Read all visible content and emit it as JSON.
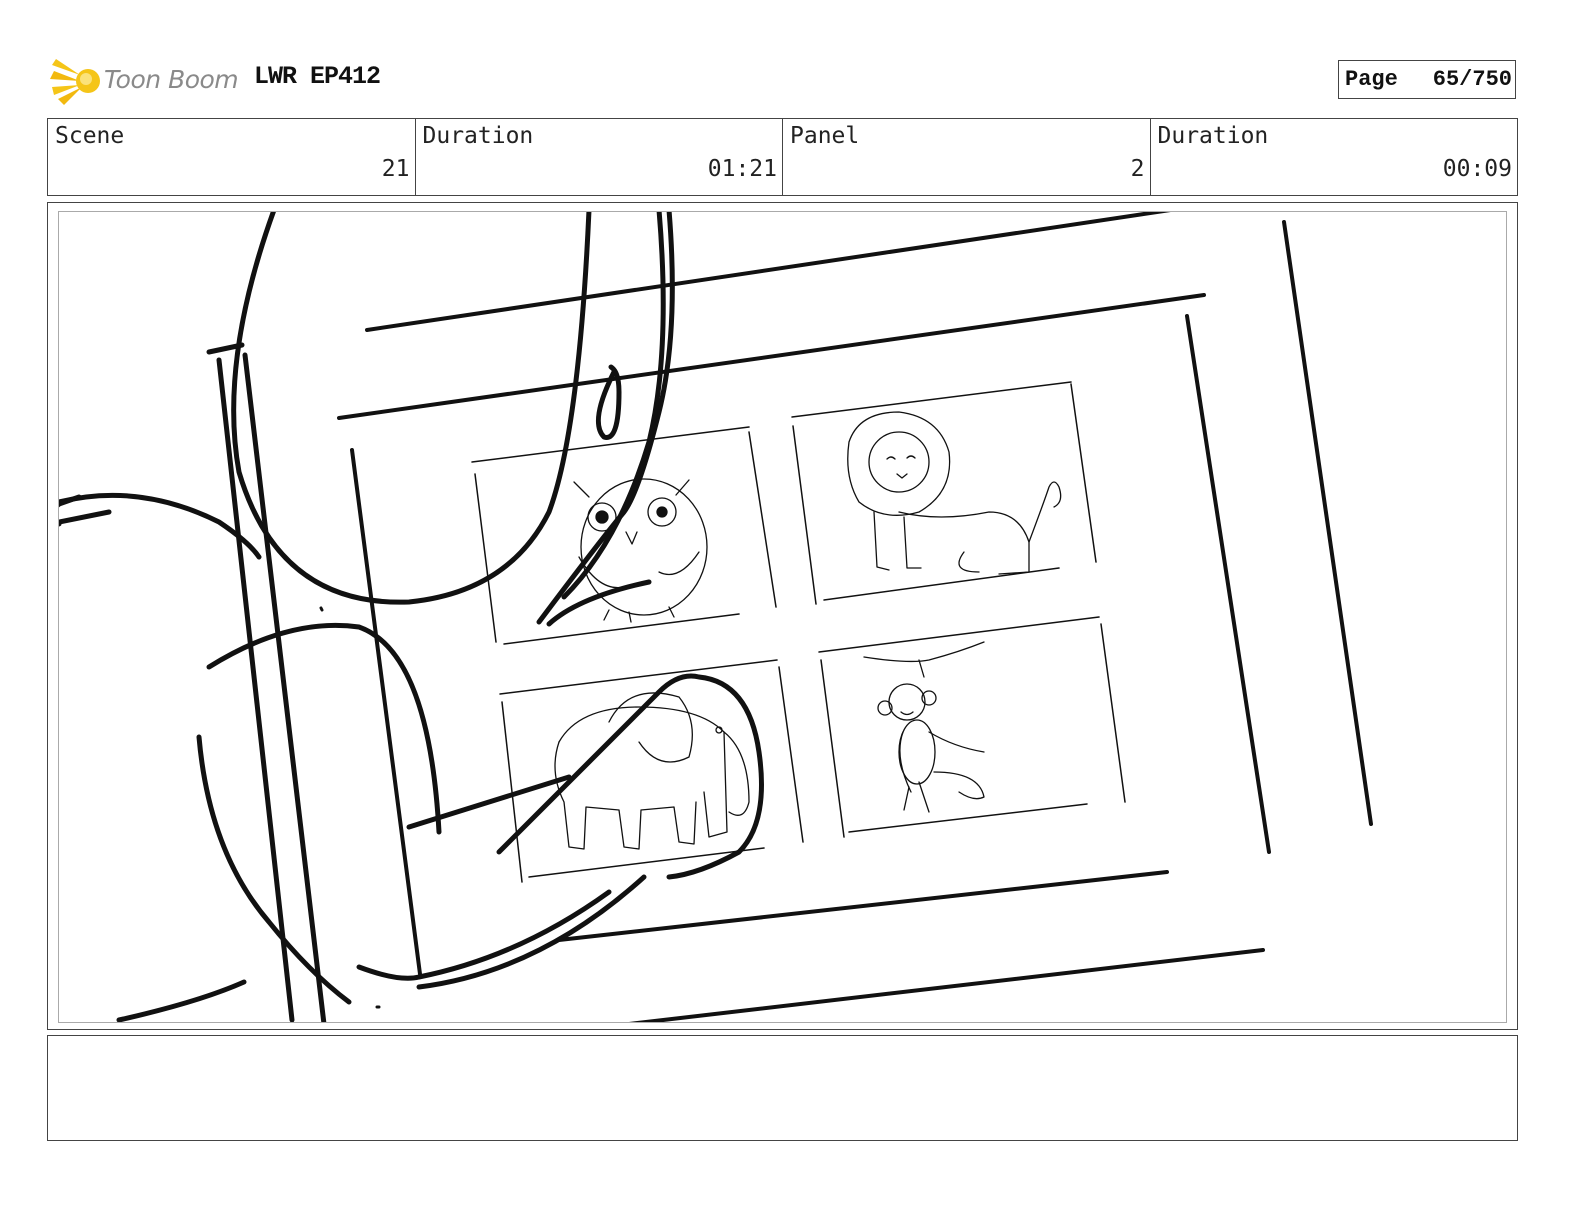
{
  "header": {
    "logo_text": "Toon Boom",
    "project_title": "LWR EP412",
    "page_label": "Page",
    "page_value": "65/750"
  },
  "info": {
    "scene_label": "Scene",
    "scene_value": "21",
    "scene_duration_label": "Duration",
    "scene_duration_value": "01:21",
    "panel_label": "Panel",
    "panel_value": "2",
    "panel_duration_label": "Duration",
    "panel_duration_value": "00:09"
  },
  "colors": {
    "logo_accent": "#f5c518",
    "logo_text": "#8a8a8a",
    "ink": "#111111"
  },
  "icons": {
    "logo": "toon-boom-burst-icon"
  },
  "notes": {
    "text": ""
  }
}
